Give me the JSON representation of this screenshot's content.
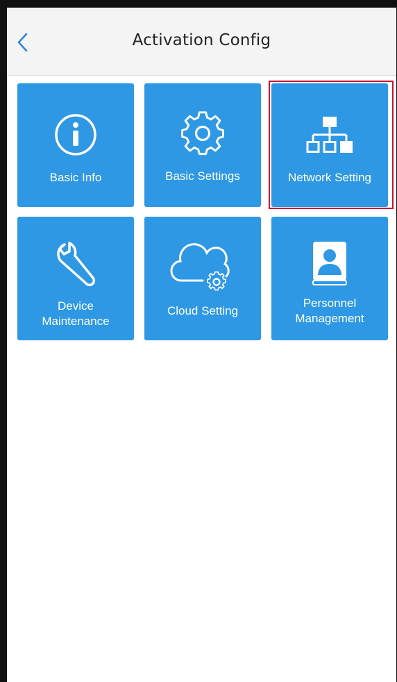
{
  "header": {
    "title": "Activation Config",
    "back_icon": "chevron-left-icon"
  },
  "colors": {
    "tile": "#2e98e4",
    "header_bg": "#f4f4f4",
    "highlight": "#c8102e",
    "back_icon": "#2e86de"
  },
  "tiles": [
    {
      "label": "Basic Info",
      "icon": "info-icon"
    },
    {
      "label": "Basic Settings",
      "icon": "gear-icon"
    },
    {
      "label": "Network Setting",
      "icon": "network-icon",
      "highlighted": true
    },
    {
      "label_line1": "Device",
      "label_line2": "Maintenance",
      "icon": "wrench-icon"
    },
    {
      "label": "Cloud Setting",
      "icon": "cloud-gear-icon"
    },
    {
      "label_line1": "Personnel",
      "label_line2": "Management",
      "icon": "contact-book-icon"
    }
  ]
}
